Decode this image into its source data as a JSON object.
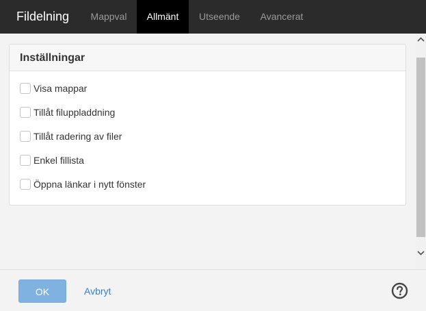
{
  "header": {
    "title": "Fildelning",
    "tabs": [
      {
        "label": "Mappval",
        "active": false
      },
      {
        "label": "Allmänt",
        "active": true
      },
      {
        "label": "Utseende",
        "active": false
      },
      {
        "label": "Avancerat",
        "active": false
      }
    ]
  },
  "panel": {
    "title": "Inställningar",
    "options": [
      {
        "label": "Visa mappar",
        "checked": false
      },
      {
        "label": "Tillåt filuppladdning",
        "checked": false
      },
      {
        "label": "Tillåt radering av filer",
        "checked": false
      },
      {
        "label": "Enkel fillista",
        "checked": false
      },
      {
        "label": "Öppna länkar i nytt fönster",
        "checked": false
      }
    ]
  },
  "footer": {
    "ok_label": "OK",
    "cancel_label": "Avbryt",
    "help_icon": "question-circle-icon"
  },
  "colors": {
    "topbar": "#2b2b2b",
    "ok_button": "#7fb2e0",
    "link": "#3a7fc4"
  }
}
